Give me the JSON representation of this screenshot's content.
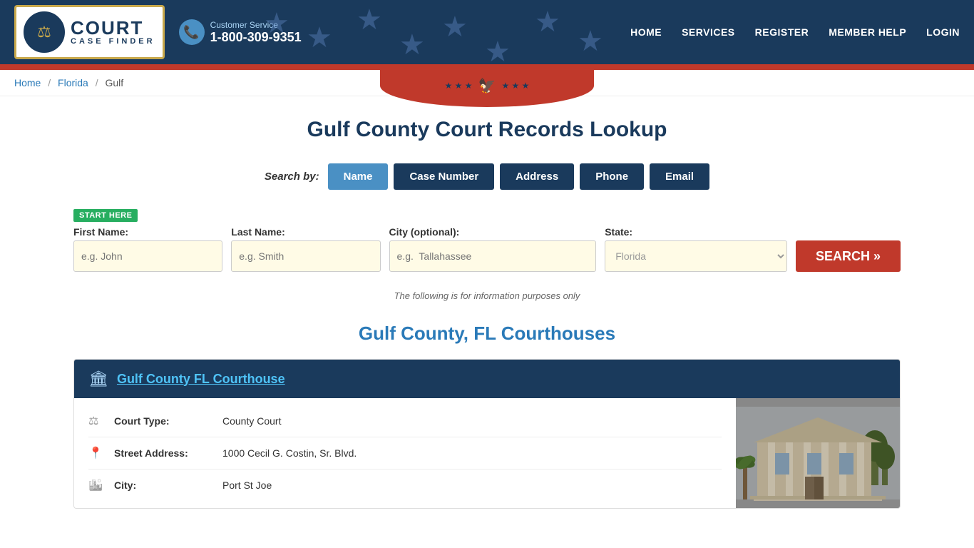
{
  "header": {
    "logo": {
      "court_text": "COURT",
      "case_finder_text": "CASE FINDER",
      "emblem": "⚖"
    },
    "customer_service_label": "Customer Service",
    "phone": "1-800-309-9351",
    "nav": [
      {
        "label": "HOME",
        "href": "#"
      },
      {
        "label": "SERVICES",
        "href": "#"
      },
      {
        "label": "REGISTER",
        "href": "#"
      },
      {
        "label": "MEMBER HELP",
        "href": "#"
      },
      {
        "label": "LOGIN",
        "href": "#"
      }
    ]
  },
  "breadcrumb": {
    "home": "Home",
    "florida": "Florida",
    "gulf": "Gulf"
  },
  "page": {
    "title": "Gulf County Court Records Lookup",
    "info_note": "The following is for information purposes only",
    "courthouses_title": "Gulf County, FL Courthouses"
  },
  "search": {
    "by_label": "Search by:",
    "tabs": [
      {
        "label": "Name",
        "active": true
      },
      {
        "label": "Case Number",
        "active": false
      },
      {
        "label": "Address",
        "active": false
      },
      {
        "label": "Phone",
        "active": false
      },
      {
        "label": "Email",
        "active": false
      }
    ],
    "start_here_badge": "START HERE",
    "fields": {
      "first_name_label": "First Name:",
      "first_name_placeholder": "e.g. John",
      "last_name_label": "Last Name:",
      "last_name_placeholder": "e.g. Smith",
      "city_label": "City (optional):",
      "city_placeholder": "e.g.  Tallahassee",
      "state_label": "State:",
      "state_value": "Florida"
    },
    "button_label": "SEARCH »"
  },
  "courthouse": {
    "name": "Gulf County FL Courthouse",
    "details": [
      {
        "icon": "⚖",
        "label": "Court Type:",
        "value": "County Court"
      },
      {
        "icon": "📍",
        "label": "Street Address:",
        "value": "1000 Cecil G. Costin, Sr. Blvd."
      },
      {
        "icon": "🏙",
        "label": "City:",
        "value": "Port St Joe"
      }
    ]
  },
  "colors": {
    "navy": "#1a3a5c",
    "red": "#c0392b",
    "blue_link": "#2a7ab8",
    "light_blue": "#4a90c4",
    "green_badge": "#27ae60",
    "input_bg": "#fffbe6"
  }
}
